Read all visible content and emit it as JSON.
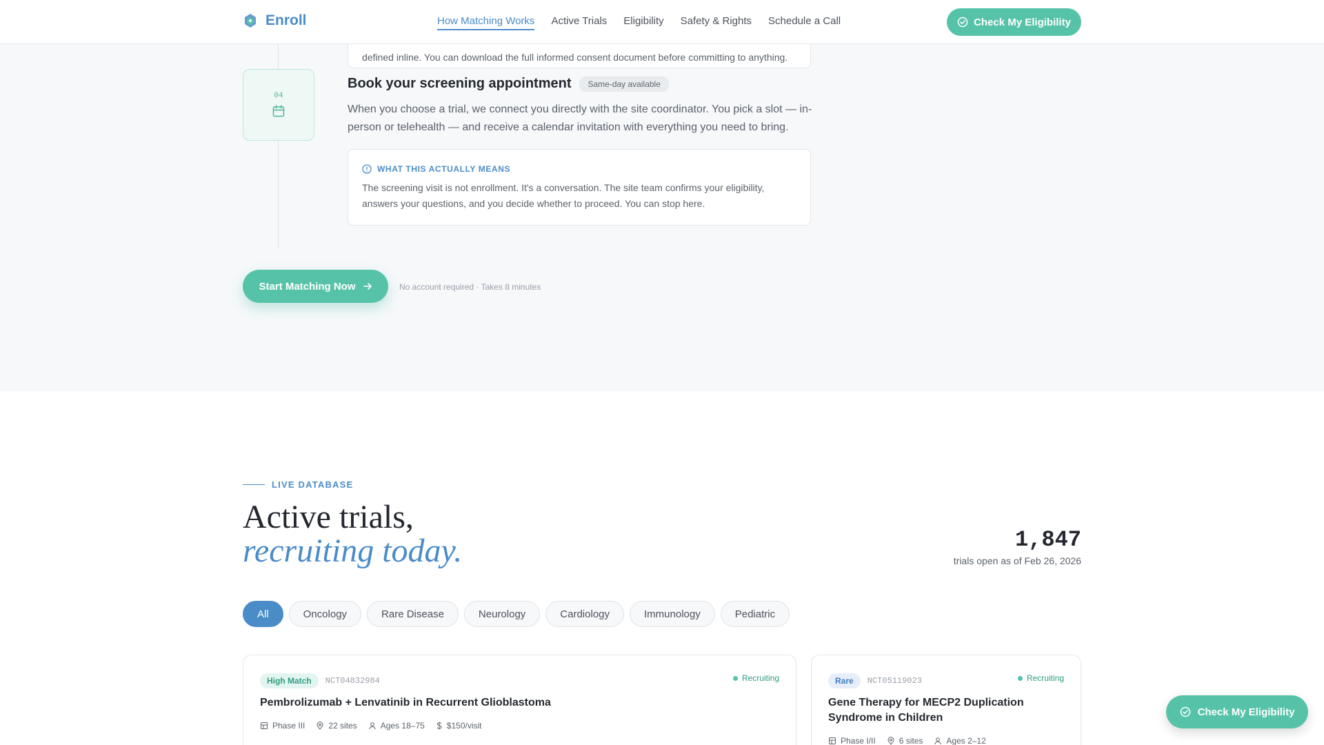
{
  "header": {
    "logo_text": "Enroll",
    "logo_icon": "molecule-logo-icon",
    "nav": [
      {
        "label": "How Matching Works",
        "active": true
      },
      {
        "label": "Active Trials"
      },
      {
        "label": "Eligibility"
      },
      {
        "label": "Safety & Rights"
      },
      {
        "label": "Schedule a Call"
      }
    ],
    "cta_label": "Check My Eligibility",
    "cta_icon": "check-circle-icon"
  },
  "steps": {
    "prev_card_text": "defined inline. You can download the full informed consent document before committing to anything.",
    "step": {
      "number": "04",
      "icon": "calendar-icon",
      "title": "Book your screening appointment",
      "tag": "Same-day available",
      "description": "When you choose a trial, we connect you directly with the site coordinator. You pick a slot — in-person or telehealth — and receive a calendar invitation with everything you need to bring.",
      "info_label": "WHAT THIS ACTUALLY MEANS",
      "info_icon": "info-circle-icon",
      "info_text": "The screening visit is not enrollment. It's a conversation. The site team confirms your eligibility, answers your questions, and you decide whether to proceed. You can stop here."
    },
    "start_label": "Start Matching Now",
    "start_note": "No account required · Takes 8 minutes"
  },
  "database": {
    "eyebrow": "LIVE DATABASE",
    "headline": "Active trials,",
    "headline_italic": "recruiting today.",
    "stat_number": "1,847",
    "stat_label": "trials open as of Feb 26, 2026",
    "filters": [
      "All",
      "Oncology",
      "Rare Disease",
      "Neurology",
      "Cardiology",
      "Immunology",
      "Pediatric"
    ],
    "active_filter": "All",
    "trials": [
      {
        "badge": "High Match",
        "nct": "NCT04832984",
        "status": "Recruiting",
        "title": "Pembrolizumab + Lenvatinib in Recurrent Glioblastoma",
        "phase": "Phase III",
        "sites": "22 sites",
        "ages": "Ages 18–75",
        "pay": "$150/visit"
      },
      {
        "badge": "Rare",
        "nct": "NCT05119023",
        "status": "Recruiting",
        "title": "Gene Therapy for MECP2 Duplication Syndrome in Children",
        "phase": "Phase I/II",
        "sites": "6 sites",
        "ages": "Ages 2–12"
      }
    ]
  },
  "floating_cta": {
    "label": "Check My Eligibility",
    "icon": "check-circle-icon"
  },
  "colors": {
    "brand_blue": "#4a8cc8",
    "brand_green": "#56c3a9"
  }
}
